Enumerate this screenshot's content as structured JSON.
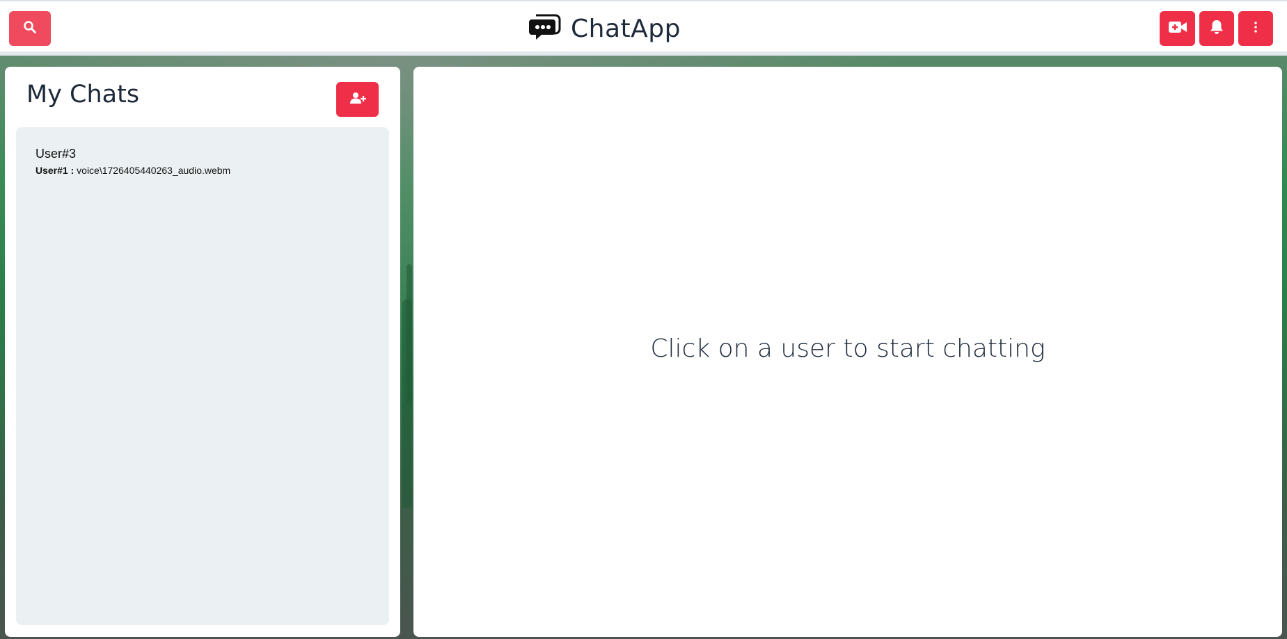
{
  "app": {
    "title": "ChatApp",
    "accent_color": "#ef2e48"
  },
  "header": {
    "search_icon": "search-icon",
    "video_icon": "video-plus-icon",
    "bell_icon": "bell-icon",
    "more_icon": "vertical-ellipsis-icon",
    "logo_icon": "chat-bubbles-icon"
  },
  "sidebar": {
    "title": "My Chats",
    "new_group_icon": "add-user-icon",
    "chats": [
      {
        "name": "User#3",
        "last_sender": "User#1 :",
        "last_message": "voice\\1726405440263_audio.webm"
      }
    ]
  },
  "main": {
    "empty_text": "Click on a user to start chatting"
  }
}
